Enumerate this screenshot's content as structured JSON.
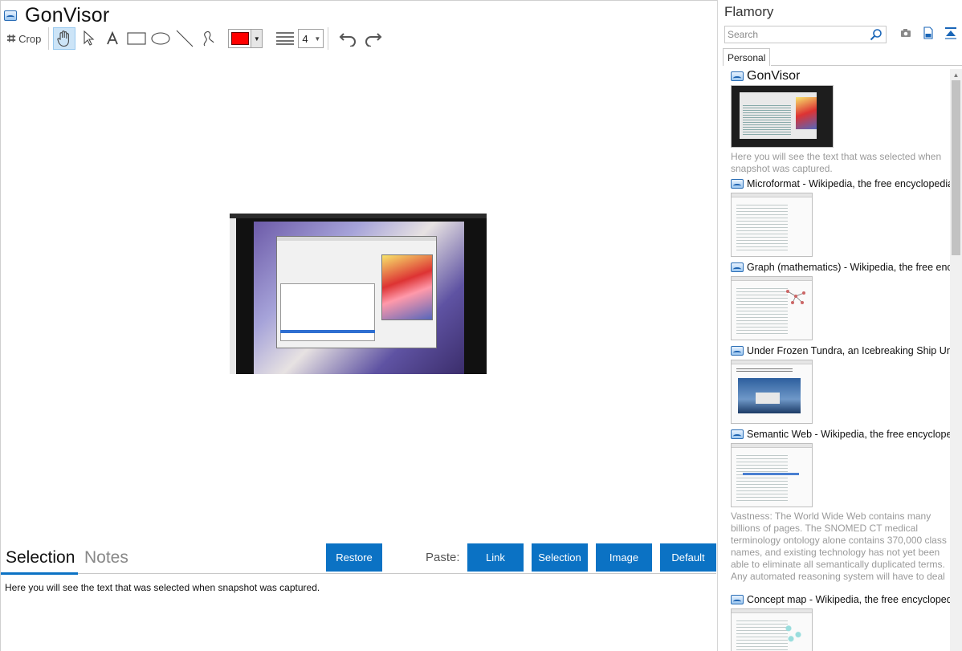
{
  "window": {
    "title": "GonVisor"
  },
  "toolbar": {
    "crop_label": "Crop",
    "line_width": "4",
    "color": "#ff0000",
    "icons": [
      "crop-icon",
      "hand-icon",
      "pointer-icon",
      "text-icon",
      "rectangle-icon",
      "ellipse-icon",
      "line-icon",
      "freehand-icon",
      "line-width-icon",
      "undo-icon",
      "redo-icon"
    ]
  },
  "bottom": {
    "tab_selection": "Selection",
    "tab_notes": "Notes",
    "restore": "Restore",
    "paste_label": "Paste:",
    "link": "Link",
    "selection": "Selection",
    "image": "Image",
    "default": "Default",
    "selection_text": "Here you will see the text that was selected when snapshot was captured."
  },
  "sidebar": {
    "title": "Flamory",
    "search_placeholder": "Search",
    "tab": "Personal",
    "items": [
      {
        "title": "GonVisor",
        "text": "Here you will see the text that was selected when snapshot was captured."
      },
      {
        "title": "Microformat - Wikipedia, the free encyclopedia",
        "text": ""
      },
      {
        "title": "Graph (mathematics) - Wikipedia, the free ency",
        "text": ""
      },
      {
        "title": "Under Frozen Tundra, an Icebreaking Ship Unco",
        "text": ""
      },
      {
        "title": "Semantic Web - Wikipedia, the free encycloped",
        "text": "Vastness: The World Wide Web contains many billions of pages. The SNOMED CT medical terminology ontology alone contains 370,000 class names, and existing technology has not yet been able to eliminate all semantically duplicated terms. Any automated reasoning system will have to deal with truly huge inputs."
      },
      {
        "title": "Concept map - Wikipedia, the free encyclopedia",
        "text": ""
      }
    ]
  },
  "colors": {
    "accent": "#0b72c4",
    "tab_active_underline": "#0b72c4",
    "muted_text": "#9a9a9a"
  }
}
